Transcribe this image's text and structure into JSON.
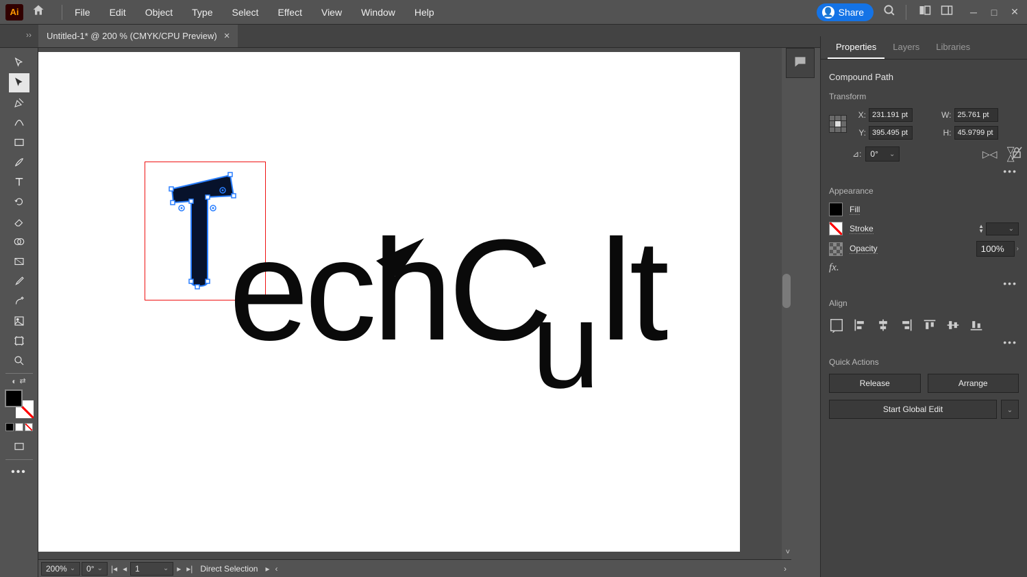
{
  "menubar": {
    "items": [
      "File",
      "Edit",
      "Object",
      "Type",
      "Select",
      "Effect",
      "View",
      "Window",
      "Help"
    ],
    "share": "Share"
  },
  "document": {
    "tab": "Untitled-1* @ 200 % (CMYK/CPU Preview)"
  },
  "status": {
    "zoom": "200%",
    "rotate": "0°",
    "artboard": "1",
    "mode": "Direct Selection"
  },
  "canvas": {
    "logo_rest": "echCult",
    "logo_sub_index": 4
  },
  "panel": {
    "tabs": [
      "Properties",
      "Layers",
      "Libraries"
    ],
    "selection_type": "Compound Path",
    "sections": {
      "transform": "Transform",
      "appearance": "Appearance",
      "align": "Align",
      "quick_actions": "Quick Actions"
    },
    "transform": {
      "x_label": "X:",
      "x": "231.191 pt",
      "y_label": "Y:",
      "y": "395.495 pt",
      "w_label": "W:",
      "w": "25.761 pt",
      "h_label": "H:",
      "h": "45.9799 pt",
      "angle": "0°"
    },
    "appearance": {
      "fill": "Fill",
      "stroke": "Stroke",
      "opacity_label": "Opacity",
      "opacity": "100%"
    },
    "quick": {
      "release": "Release",
      "arrange": "Arrange",
      "global_edit": "Start Global Edit"
    }
  }
}
